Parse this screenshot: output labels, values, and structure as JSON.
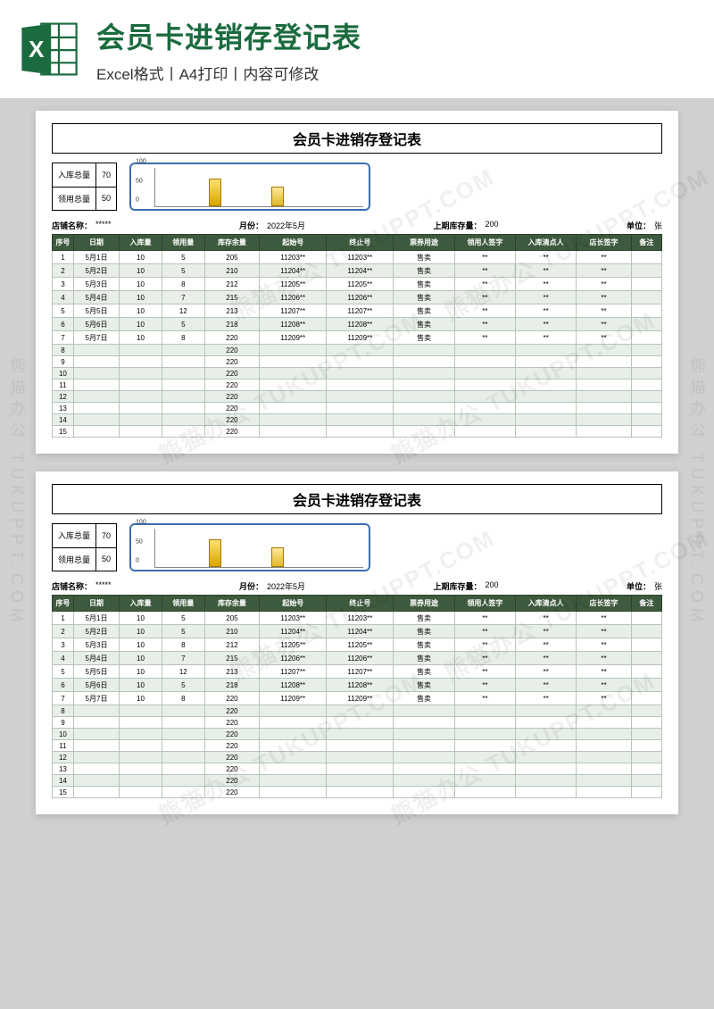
{
  "header": {
    "title": "会员卡进销存登记表",
    "subtitle": "Excel格式丨A4打印丨内容可修改"
  },
  "sheet": {
    "title": "会员卡进销存登记表",
    "totals": {
      "in_label": "入库总量",
      "in_value": "70",
      "out_label": "领用总量",
      "out_value": "50"
    },
    "info": {
      "store_label": "店铺名称：",
      "store_value": "*****",
      "month_label": "月份：",
      "month_value": "2022年5月",
      "prev_label": "上期库存量：",
      "prev_value": "200",
      "unit_label": "单位：",
      "unit_value": "张"
    },
    "columns": [
      "序号",
      "日期",
      "入库量",
      "领用量",
      "库存余量",
      "起始号",
      "终止号",
      "票券用途",
      "领用人签字",
      "入库清点人",
      "店长签字",
      "备注"
    ],
    "rows": [
      {
        "n": "1",
        "d": "5月1日",
        "i": "10",
        "o": "5",
        "bal": "205",
        "s": "11203**",
        "e": "11203**",
        "u": "售卖",
        "a": "**",
        "b": "**",
        "c": "**",
        "r": ""
      },
      {
        "n": "2",
        "d": "5月2日",
        "i": "10",
        "o": "5",
        "bal": "210",
        "s": "11204**",
        "e": "11204**",
        "u": "售卖",
        "a": "**",
        "b": "**",
        "c": "**",
        "r": ""
      },
      {
        "n": "3",
        "d": "5月3日",
        "i": "10",
        "o": "8",
        "bal": "212",
        "s": "11205**",
        "e": "11205**",
        "u": "售卖",
        "a": "**",
        "b": "**",
        "c": "**",
        "r": ""
      },
      {
        "n": "4",
        "d": "5月4日",
        "i": "10",
        "o": "7",
        "bal": "215",
        "s": "11206**",
        "e": "11206**",
        "u": "售卖",
        "a": "**",
        "b": "**",
        "c": "**",
        "r": ""
      },
      {
        "n": "5",
        "d": "5月5日",
        "i": "10",
        "o": "12",
        "bal": "213",
        "s": "11207**",
        "e": "11207**",
        "u": "售卖",
        "a": "**",
        "b": "**",
        "c": "**",
        "r": ""
      },
      {
        "n": "6",
        "d": "5月6日",
        "i": "10",
        "o": "5",
        "bal": "218",
        "s": "11208**",
        "e": "11208**",
        "u": "售卖",
        "a": "**",
        "b": "**",
        "c": "**",
        "r": ""
      },
      {
        "n": "7",
        "d": "5月7日",
        "i": "10",
        "o": "8",
        "bal": "220",
        "s": "11209**",
        "e": "11209**",
        "u": "售卖",
        "a": "**",
        "b": "**",
        "c": "**",
        "r": ""
      },
      {
        "n": "8",
        "d": "",
        "i": "",
        "o": "",
        "bal": "220",
        "s": "",
        "e": "",
        "u": "",
        "a": "",
        "b": "",
        "c": "",
        "r": ""
      },
      {
        "n": "9",
        "d": "",
        "i": "",
        "o": "",
        "bal": "220",
        "s": "",
        "e": "",
        "u": "",
        "a": "",
        "b": "",
        "c": "",
        "r": ""
      },
      {
        "n": "10",
        "d": "",
        "i": "",
        "o": "",
        "bal": "220",
        "s": "",
        "e": "",
        "u": "",
        "a": "",
        "b": "",
        "c": "",
        "r": ""
      },
      {
        "n": "11",
        "d": "",
        "i": "",
        "o": "",
        "bal": "220",
        "s": "",
        "e": "",
        "u": "",
        "a": "",
        "b": "",
        "c": "",
        "r": ""
      },
      {
        "n": "12",
        "d": "",
        "i": "",
        "o": "",
        "bal": "220",
        "s": "",
        "e": "",
        "u": "",
        "a": "",
        "b": "",
        "c": "",
        "r": ""
      },
      {
        "n": "13",
        "d": "",
        "i": "",
        "o": "",
        "bal": "220",
        "s": "",
        "e": "",
        "u": "",
        "a": "",
        "b": "",
        "c": "",
        "r": ""
      },
      {
        "n": "14",
        "d": "",
        "i": "",
        "o": "",
        "bal": "220",
        "s": "",
        "e": "",
        "u": "",
        "a": "",
        "b": "",
        "c": "",
        "r": ""
      },
      {
        "n": "15",
        "d": "",
        "i": "",
        "o": "",
        "bal": "220",
        "s": "",
        "e": "",
        "u": "",
        "a": "",
        "b": "",
        "c": "",
        "r": ""
      }
    ]
  },
  "chart_data": {
    "type": "bar",
    "categories": [
      "入库总量",
      "领用总量"
    ],
    "values": [
      70,
      50
    ],
    "title": "",
    "xlabel": "",
    "ylabel": "",
    "ylim": [
      0,
      100
    ],
    "yticks": [
      0,
      50,
      100
    ]
  },
  "watermark": "熊猫办公 TUKUPPT.COM"
}
